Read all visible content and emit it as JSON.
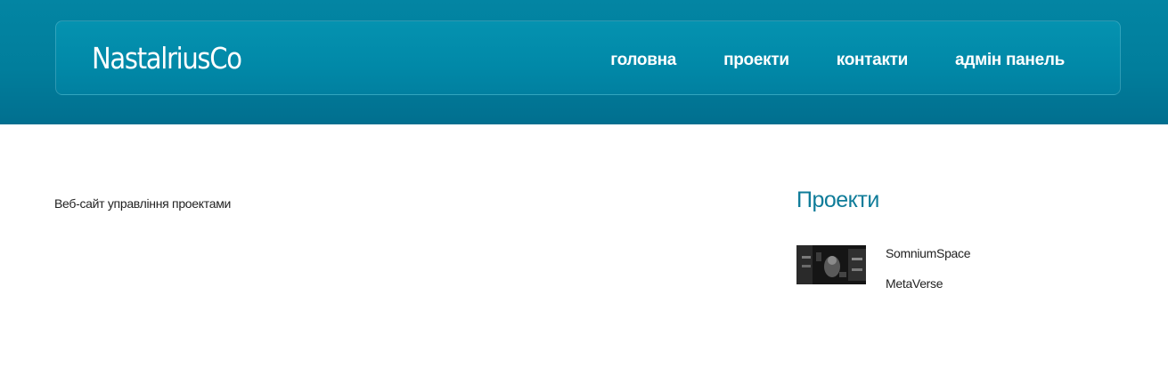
{
  "header": {
    "logo": "NastalriusCo",
    "nav": [
      {
        "label": "головна"
      },
      {
        "label": "проекти"
      },
      {
        "label": "контакти"
      },
      {
        "label": "адмін панель"
      }
    ]
  },
  "main": {
    "intro_text": "Веб-сайт управління проектами"
  },
  "sidebar": {
    "title": "Проекти",
    "projects": [
      {
        "name": "SomniumSpace"
      },
      {
        "name": "MetaVerse"
      }
    ]
  },
  "colors": {
    "header_bg": "#0189a8",
    "accent": "#0f7c99",
    "text": "#222222"
  }
}
